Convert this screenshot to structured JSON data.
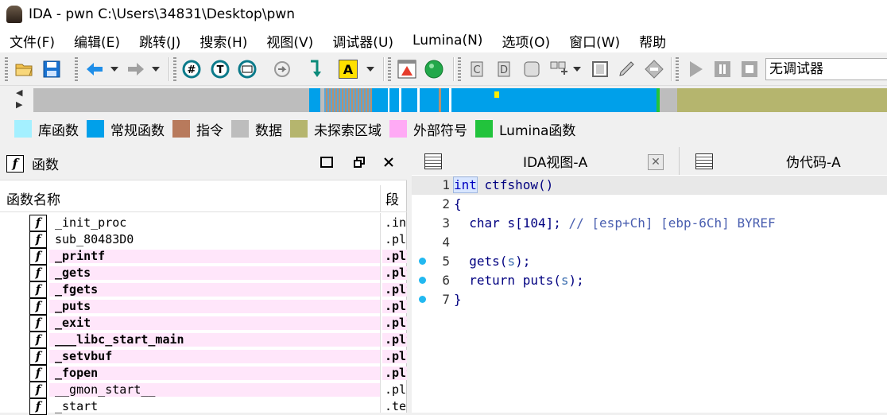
{
  "window": {
    "title": "IDA - pwn C:\\Users\\34831\\Desktop\\pwn"
  },
  "menu": [
    "文件(F)",
    "编辑(E)",
    "跳转(J)",
    "搜索(H)",
    "视图(V)",
    "调试器(U)",
    "Lumina(N)",
    "选项(O)",
    "窗口(W)",
    "帮助"
  ],
  "toolbar": {
    "debugger_select": "无调试器",
    "icons": [
      "open-icon",
      "save-icon",
      "back-icon",
      "forward-icon",
      "hex-view-icon",
      "text-view-icon",
      "graph-view-icon",
      "jump-icon",
      "step-into-icon",
      "strings-icon",
      "segment-icon",
      "debug-run-icon",
      "c-code-icon",
      "d-data-icon",
      "struct-icon",
      "enum-icon",
      "undefine-icon",
      "edit-icon",
      "comment-icon",
      "run-icon",
      "pause-icon",
      "stop-icon"
    ],
    "colors": {
      "accent_blue": "#0078d7",
      "red_segment": "#e63c2c",
      "green_dot": "#22a84a"
    }
  },
  "legend": [
    {
      "label": "库函数",
      "color": "#a4f0ff"
    },
    {
      "label": "常规函数",
      "color": "#00a0ea"
    },
    {
      "label": "指令",
      "color": "#b87a5c"
    },
    {
      "label": "数据",
      "color": "#bdbdbd"
    },
    {
      "label": "未探索区域",
      "color": "#b5b56e"
    },
    {
      "label": "外部符号",
      "color": "#ffaaf5"
    },
    {
      "label": "Lumina函数",
      "color": "#22c33c"
    }
  ],
  "functions_panel": {
    "title": "函数",
    "col_name": "函数名称",
    "col_segment": "段",
    "rows": [
      {
        "name": "_init_proc",
        "segment": ".init",
        "external": false
      },
      {
        "name": "sub_80483D0",
        "segment": ".plt",
        "external": false
      },
      {
        "name": "_printf",
        "segment": ".plt",
        "external": true
      },
      {
        "name": "_gets",
        "segment": ".plt",
        "external": true
      },
      {
        "name": "_fgets",
        "segment": ".plt",
        "external": true
      },
      {
        "name": "_puts",
        "segment": ".plt",
        "external": true
      },
      {
        "name": "_exit",
        "segment": ".plt",
        "external": true
      },
      {
        "name": "___libc_start_main",
        "segment": ".plt",
        "external": true
      },
      {
        "name": "_setvbuf",
        "segment": ".plt",
        "external": true
      },
      {
        "name": "_fopen",
        "segment": ".plt",
        "external": true
      },
      {
        "name": "__gmon_start__",
        "segment": ".plt",
        "external": false
      },
      {
        "name": "_start",
        "segment": ".text",
        "external": false
      }
    ]
  },
  "tabs": [
    {
      "label": "IDA视图-A",
      "active": true
    },
    {
      "label": "伪代码-A",
      "active": false
    }
  ],
  "code": {
    "lines": [
      {
        "num": "1",
        "bp": false
      },
      {
        "num": "2",
        "bp": false
      },
      {
        "num": "3",
        "bp": false
      },
      {
        "num": "4",
        "bp": false
      },
      {
        "num": "5",
        "bp": true
      },
      {
        "num": "6",
        "bp": true
      },
      {
        "num": "7",
        "bp": true
      }
    ],
    "l1": {
      "kw": "int",
      "fn": "ctfshow()"
    },
    "l2": "{",
    "l3": {
      "type": "char",
      "decl": "s[104];",
      "comment": "// [esp+Ch] [ebp-6Ch] BYREF"
    },
    "l5": {
      "fn": "gets(",
      "arg": "s",
      "end": ");"
    },
    "l6": {
      "kw": "return",
      "fn": "puts(",
      "arg": "s",
      "end": ");"
    },
    "l7": "}"
  }
}
